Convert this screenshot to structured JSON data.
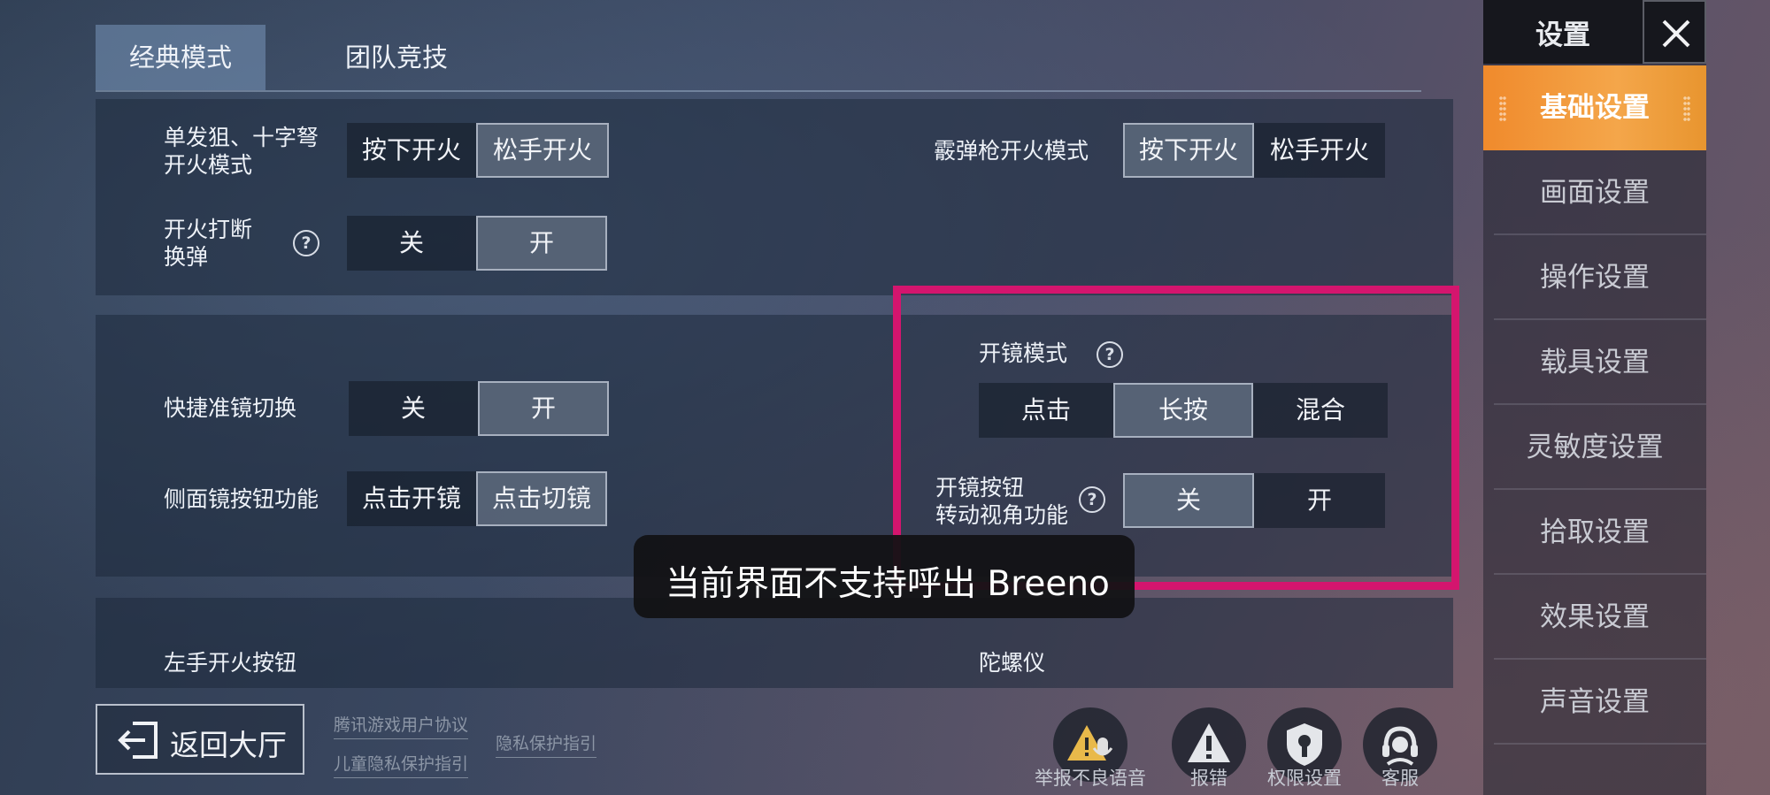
{
  "tabs": [
    "经典模式",
    "团队竞技"
  ],
  "panel1": {
    "sniper_label_1": "单发狙、十字弩",
    "sniper_label_2": "开火模式",
    "sniper_options": [
      "按下开火",
      "松手开火"
    ],
    "sniper_selected": "松手开火",
    "shotgun_label": "霰弹枪开火模式",
    "shotgun_options": [
      "按下开火",
      "松手开火"
    ],
    "shotgun_selected": "按下开火",
    "interrupt_label_1": "开火打断",
    "interrupt_label_2": "换弹",
    "interrupt_options": [
      "关",
      "开"
    ],
    "interrupt_selected": "开"
  },
  "panel2": {
    "quick_scope_label": "快捷准镜切换",
    "quick_scope_options": [
      "关",
      "开"
    ],
    "quick_scope_selected": "开",
    "side_scope_label": "侧面镜按钮功能",
    "side_scope_options": [
      "点击开镜",
      "点击切镜"
    ],
    "side_scope_selected": "点击切镜",
    "scope_mode_label": "开镜模式",
    "scope_mode_options": [
      "点击",
      "长按",
      "混合"
    ],
    "scope_mode_selected": "长按",
    "scope_turn_label_1": "开镜按钮",
    "scope_turn_label_2": "转动视角功能",
    "scope_turn_options": [
      "关",
      "开"
    ],
    "scope_turn_selected": "关"
  },
  "panel3": {
    "left_fire_label": "左手开火按钮",
    "gyro_label": "陀螺仪"
  },
  "toast": "当前界面不支持呼出 Breeno",
  "sidebar": {
    "title": "设置",
    "items": [
      "基础设置",
      "画面设置",
      "操作设置",
      "载具设置",
      "灵敏度设置",
      "拾取设置",
      "效果设置",
      "声音设置"
    ],
    "active": "基础设置"
  },
  "footer": {
    "back_label": "返回大厅",
    "links": [
      "腾讯游戏用户协议",
      "儿童隐私保护指引",
      "隐私保护指引"
    ],
    "actions": [
      "举报不良语音",
      "报错",
      "权限设置",
      "客服"
    ]
  },
  "colors": {
    "accent_orange": "#f08a2c",
    "highlight_magenta": "#d4156e"
  }
}
